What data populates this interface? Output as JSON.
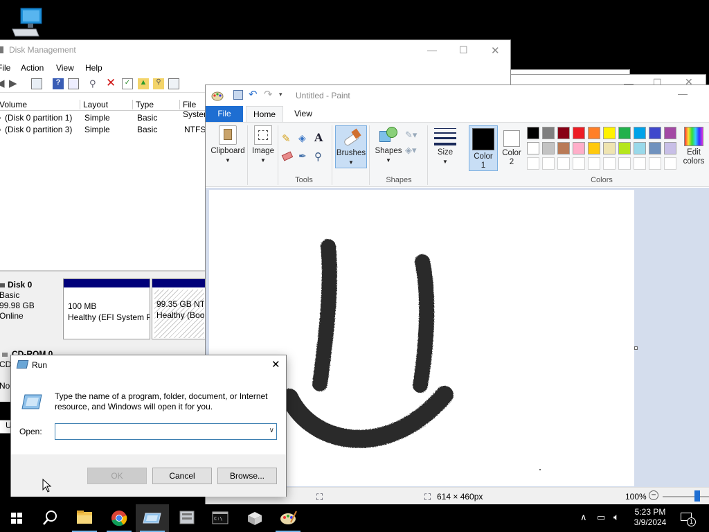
{
  "desktop": {
    "icon": "computer-icon"
  },
  "disk_management": {
    "title": "Disk Management",
    "menu": [
      "File",
      "Action",
      "View",
      "Help"
    ],
    "columns": [
      "Volume",
      "Layout",
      "Type",
      "File System"
    ],
    "volumes": [
      {
        "volume": "(Disk 0 partition 1)",
        "layout": "Simple",
        "type": "Basic",
        "fs": ""
      },
      {
        "volume": "(Disk 0 partition 3)",
        "layout": "Simple",
        "type": "Basic",
        "fs": "NTFS"
      }
    ],
    "disk0": {
      "name": "Disk 0",
      "type": "Basic",
      "size": "99.98 GB",
      "status": "Online",
      "partitions": [
        {
          "size": "100 MB",
          "status": "Healthy (EFI System P"
        },
        {
          "size": "99.35 GB NTF",
          "status": "Healthy (Boo"
        }
      ]
    },
    "cdrom": {
      "name": "CD-ROM 0",
      "line1": "CD-",
      "line2": "No"
    },
    "legend": "U"
  },
  "paint": {
    "title": "Untitled - Paint",
    "tabs": {
      "file": "File",
      "home": "Home",
      "view": "View"
    },
    "ribbon": {
      "clipboard": "Clipboard",
      "image": "Image",
      "tools_group": "Tools",
      "brushes": "Brushes",
      "shapes": "Shapes",
      "shapes_group": "Shapes",
      "size": "Size",
      "color1": "Color",
      "color1_num": "1",
      "color2": "Color",
      "color2_num": "2",
      "edit_colors_1": "Edit",
      "edit_colors_2": "colors",
      "colors_group": "Colors"
    },
    "palette_row1": [
      "#000000",
      "#7f7f7f",
      "#880015",
      "#ed1c24",
      "#ff7f27",
      "#fff200",
      "#22b14c",
      "#00a2e8",
      "#3f48cc",
      "#a349a4"
    ],
    "palette_row2": [
      "#ffffff",
      "#c3c3c3",
      "#b97a57",
      "#ffaec9",
      "#ffc90e",
      "#efe4b0",
      "#b5e61d",
      "#99d9ea",
      "#7092be",
      "#c8bfe7"
    ],
    "status": {
      "dimensions": "614 × 460px",
      "zoom": "100%"
    }
  },
  "run": {
    "title": "Run",
    "message": "Type the name of a program, folder, document, or Internet resource, and Windows will open it for you.",
    "open_label": "Open:",
    "open_value": "",
    "ok": "OK",
    "cancel": "Cancel",
    "browse": "Browse..."
  },
  "taskbar": {
    "apps": [
      "start-icon",
      "search-icon",
      "file-explorer-icon",
      "chrome-icon",
      "disk-management-icon",
      "server-manager-icon",
      "cmd-icon",
      "package-icon",
      "paint-icon"
    ],
    "time": "5:23 PM",
    "date": "3/9/2024",
    "notifications": "1"
  }
}
